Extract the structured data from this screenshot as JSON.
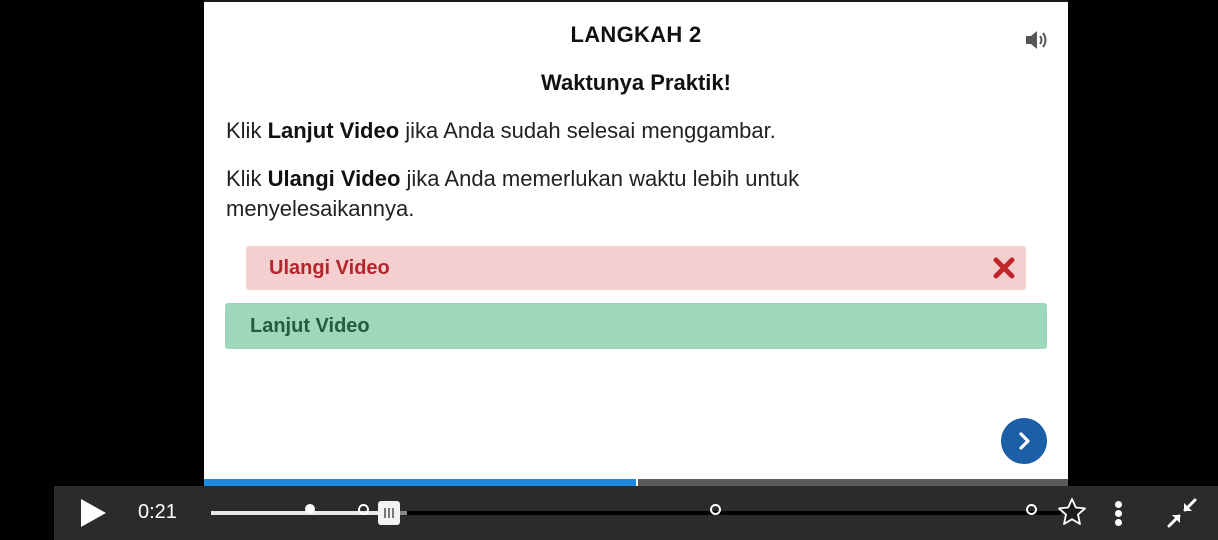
{
  "card": {
    "step_title": "LANGKAH 2",
    "heading": "Waktunya Praktik!",
    "para1": {
      "prefix": "Klik ",
      "bold": "Lanjut Video",
      "suffix": " jika Anda sudah selesai menggambar."
    },
    "para2": {
      "prefix": "Klik ",
      "bold": "Ulangi Video",
      "suffix": " jika Anda memerlukan waktu lebih untuk menyelesaikannya."
    },
    "retry_label": "Ulangi Video",
    "continue_label": "Lanjut Video",
    "icons": {
      "audio": "speaker-icon",
      "retry": "close-icon",
      "next": "chevron-right-icon"
    }
  },
  "lesson_progress": {
    "fraction": 0.5
  },
  "player": {
    "time": "0:21",
    "playback_fraction": 0.2,
    "icons": {
      "play": "play-icon",
      "favorite": "star-icon",
      "more": "more-vertical-icon",
      "exit_fullscreen": "exit-fullscreen-icon"
    }
  },
  "colors": {
    "retry_bg": "#f5cfcf",
    "retry_text": "#b3262d",
    "continue_bg": "#9dd8bd",
    "continue_text": "#245c3d",
    "next_button": "#1b5fa8",
    "progress_fill": "#1f8be0"
  }
}
